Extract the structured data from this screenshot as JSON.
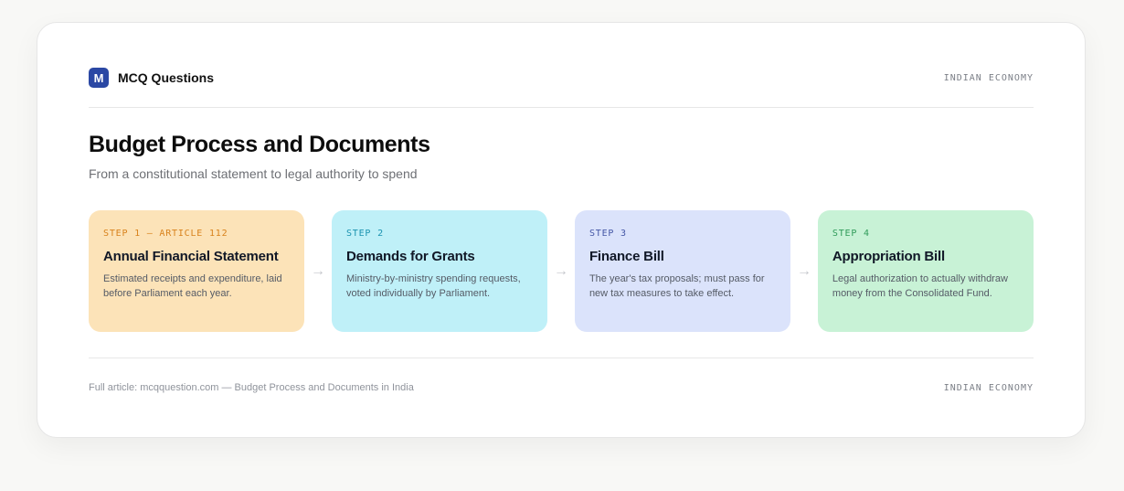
{
  "header": {
    "logo_letter": "M",
    "brand": "MCQ Questions",
    "category": "INDIAN ECONOMY"
  },
  "title": "Budget Process and Documents",
  "subtitle": "From a constitutional statement to legal authority to spend",
  "arrow_glyph": "→",
  "steps": [
    {
      "label": "STEP 1 — ARTICLE 112",
      "title": "Annual Financial Statement",
      "description": "Estimated receipts and expenditure, laid before Parliament each year.",
      "bg": "#fce3b8",
      "label_color": "#d8821c"
    },
    {
      "label": "STEP 2",
      "title": "Demands for Grants",
      "description": "Ministry-by-ministry spending requests, voted individually by Parliament.",
      "bg": "#bff0f8",
      "label_color": "#1b93b0"
    },
    {
      "label": "STEP 3",
      "title": "Finance Bill",
      "description": "The year's tax proposals; must pass for new tax measures to take effect.",
      "bg": "#dbe3fb",
      "label_color": "#4557a6"
    },
    {
      "label": "STEP 4",
      "title": "Appropriation Bill",
      "description": "Legal authorization to actually withdraw money from the Consolidated Fund.",
      "bg": "#c8f2d6",
      "label_color": "#2f9b59"
    }
  ],
  "footer": {
    "source": "Full article: mcqquestion.com — Budget Process and Documents in India",
    "category": "INDIAN ECONOMY"
  }
}
